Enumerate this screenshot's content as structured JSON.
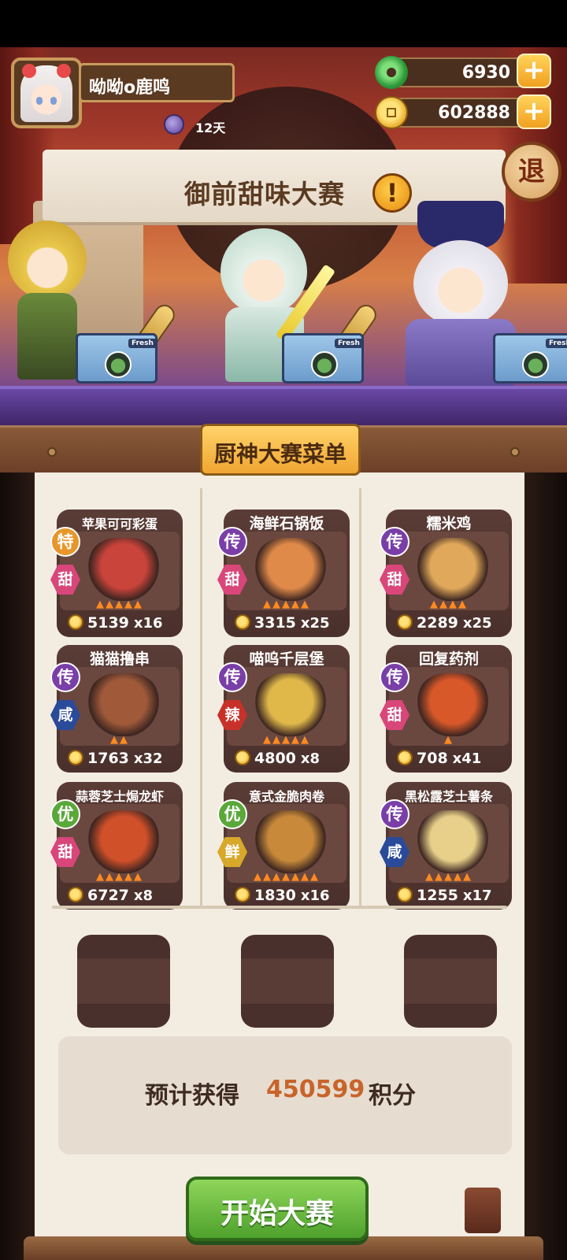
{
  "player": {
    "name": "呦呦o鹿鸣",
    "days": "12天"
  },
  "currency": {
    "jade": "6930",
    "coins": "602888"
  },
  "event": {
    "title": "御前甜味大赛",
    "alert": "!",
    "exit_label": "退"
  },
  "stage": {
    "counter_label": "Fresh"
  },
  "menu": {
    "title": "厨神大赛菜单",
    "dishes": [
      {
        "name": "苹果可可彩蛋",
        "tier": "特",
        "taste": "甜",
        "price": "5139",
        "count": "x16",
        "tier_color": "#e8962a",
        "taste_color": "#d8467a",
        "art_color": "#c9443a"
      },
      {
        "name": "海鲜石锅饭",
        "tier": "传",
        "taste": "甜",
        "price": "3315",
        "count": "x25",
        "tier_color": "#7a3ea8",
        "taste_color": "#d8467a",
        "art_color": "#e08a4a"
      },
      {
        "name": "糯米鸡",
        "tier": "传",
        "taste": "甜",
        "price": "2289",
        "count": "x25",
        "tier_color": "#7a3ea8",
        "taste_color": "#d8467a",
        "art_color": "#e0a85a"
      },
      {
        "name": "猫猫撸串",
        "tier": "传",
        "taste": "咸",
        "price": "1763",
        "count": "x32",
        "tier_color": "#7a3ea8",
        "taste_color": "#2a4a9a",
        "art_color": "#a05a3a"
      },
      {
        "name": "喵呜千层堡",
        "tier": "传",
        "taste": "辣",
        "price": "4800",
        "count": "x8",
        "tier_color": "#7a3ea8",
        "taste_color": "#c8302a",
        "art_color": "#e0b84a"
      },
      {
        "name": "回复药剂",
        "tier": "传",
        "taste": "甜",
        "price": "708",
        "count": "x41",
        "tier_color": "#7a3ea8",
        "taste_color": "#d8467a",
        "art_color": "#d8582a"
      },
      {
        "name": "蒜蓉芝士焗龙虾",
        "tier": "优",
        "taste": "甜",
        "price": "6727",
        "count": "x8",
        "tier_color": "#5aa83a",
        "taste_color": "#d8467a",
        "art_color": "#d0502a"
      },
      {
        "name": "意式金脆肉卷",
        "tier": "优",
        "taste": "鲜",
        "price": "1830",
        "count": "x16",
        "tier_color": "#5aa83a",
        "taste_color": "#d8a82a",
        "art_color": "#c88a3a"
      },
      {
        "name": "黑松露芝士薯条",
        "tier": "传",
        "taste": "咸",
        "price": "1255",
        "count": "x17",
        "tier_color": "#7a3ea8",
        "taste_color": "#2a4a9a",
        "art_color": "#e8d08a"
      }
    ]
  },
  "estimate": {
    "label": "预计获得",
    "value": "450599",
    "unit": "积分"
  },
  "start_button": {
    "label": "开始大赛"
  },
  "colors": {
    "accent": "#c8642a",
    "button_green": "#4ea12c",
    "gold": "#f0a531"
  }
}
